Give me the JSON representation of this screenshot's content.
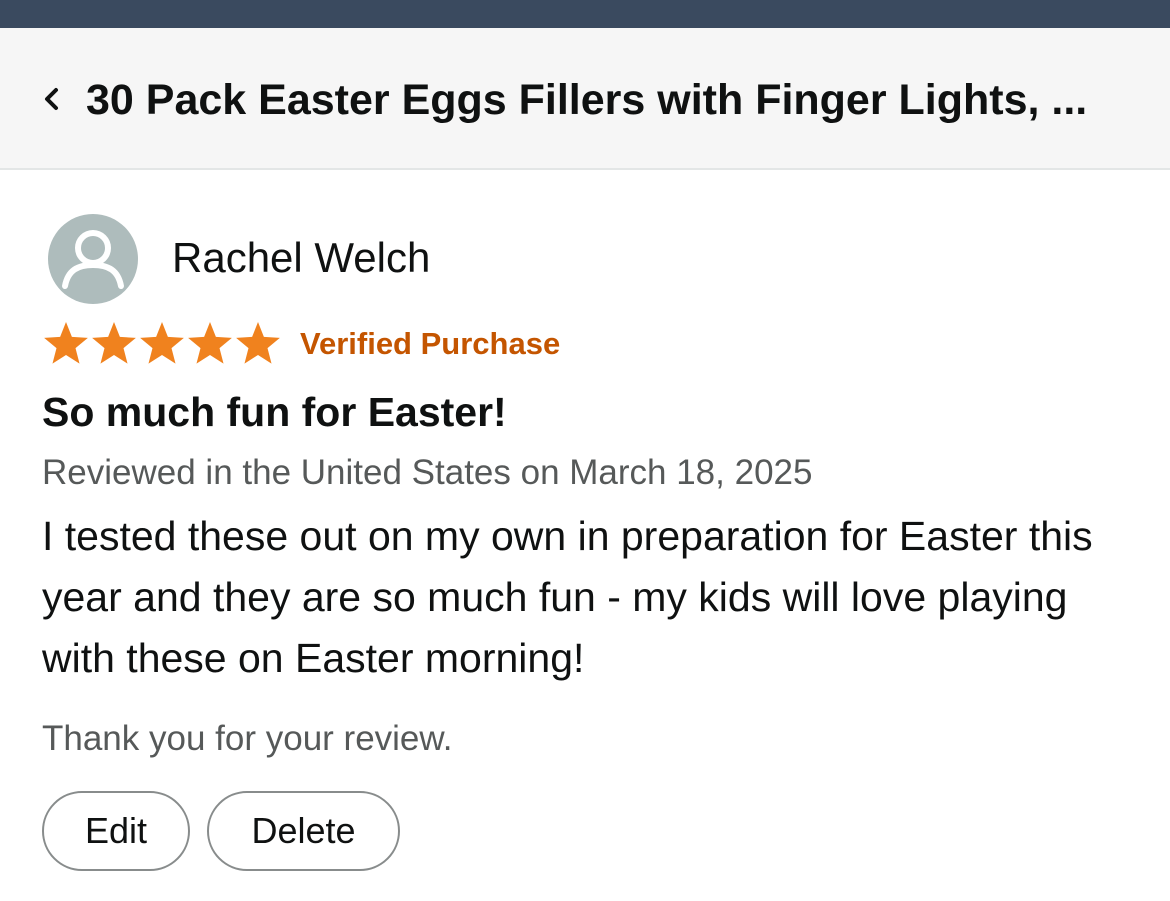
{
  "header": {
    "back_icon": "chevron-left-icon",
    "title": "30 Pack Easter Eggs Fillers with Finger Lights, ..."
  },
  "review": {
    "reviewer_name": "Rachel Welch",
    "avatar_icon": "user-avatar-icon",
    "rating": 5,
    "rating_max": 5,
    "verified_label": "Verified Purchase",
    "title": "So much fun for Easter!",
    "date_line": "Reviewed in the United States on March 18, 2025",
    "body": "I tested these out on my own in preparation for Easter this year and they are so much fun - my kids will love playing with these on Easter morning!",
    "thanks": "Thank you for your review."
  },
  "actions": {
    "edit_label": "Edit",
    "delete_label": "Delete"
  },
  "colors": {
    "top_strip": "#3a4a5f",
    "header_bg": "#f6f6f6",
    "star": "#f0821e",
    "verified": "#c45500",
    "muted_text": "#565959",
    "avatar_bg": "#aebcbc"
  }
}
